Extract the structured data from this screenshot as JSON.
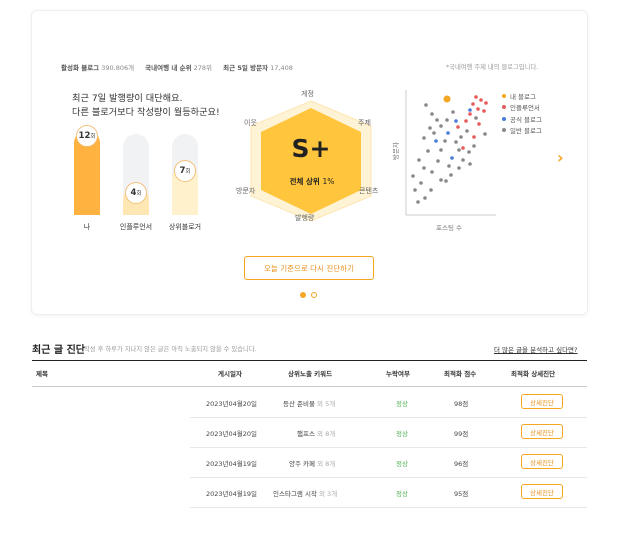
{
  "stats": {
    "active_label": "활성화 블로그",
    "active_value": "390,806개",
    "rank_label": "국내여행 내 순위",
    "rank_value": "278위",
    "visitor_label": "최근 5일 방문자",
    "visitor_value": "17,408",
    "note": "*국내여행 주제 내의 블로그입니다."
  },
  "headline": {
    "line1": "최근 7일 발행량이 대단해요.",
    "line2": "다른 블로거보다 작성량이 월등하군요!"
  },
  "bars": [
    {
      "label": "나",
      "count": "12",
      "unit": "회",
      "value": 12,
      "color": "#ffb23f"
    },
    {
      "label": "인플루언서",
      "count": "4",
      "unit": "회",
      "value": 4,
      "color": "#ffe7b3"
    },
    {
      "label": "상위블로거",
      "count": "7",
      "unit": "회",
      "value": 7,
      "color": "#fff1cc"
    }
  ],
  "hexagon": {
    "grade": "S+",
    "rank_prefix": "전체 상위",
    "rank_value": "1%",
    "labels": {
      "top": "게정",
      "top_right": "주제",
      "bottom_right": "콘텐츠",
      "bottom": "발행량",
      "bottom_left": "방문자",
      "top_left": "이웃"
    },
    "fill_color": "#ffc53d",
    "outer_color": "#fff3d6"
  },
  "scatter": {
    "ylabel": "방문자",
    "xlabel": "포스팅 수",
    "legend": [
      {
        "label": "내 블로그",
        "color": "#f5a623"
      },
      {
        "label": "인플루언서",
        "color": "#e85a5a"
      },
      {
        "label": "공식 블로그",
        "color": "#4a7bd8"
      },
      {
        "label": "일반 블로그",
        "color": "#888888"
      }
    ]
  },
  "cta_label": "오늘 기준으로 다시 진단하기",
  "next_icon": "chevron-right-icon",
  "section": {
    "title": "최근 글 진단",
    "desc": "작성 후 하루가 지나지 않은 글은 아직 노출되지 않을 수 있습니다.",
    "link": "더 많은 글을 분석하고 싶다면?"
  },
  "table": {
    "headers": [
      "제목",
      "게시일자",
      "상위노출 키워드",
      "누락여부",
      "최적화 점수",
      "최적화 상세진단"
    ],
    "rows": [
      {
        "date": "2023년04월20일",
        "keyword": "등산 준비물",
        "extra": "외 5개",
        "status": "정상",
        "score": "98점",
        "action": "상세진단"
      },
      {
        "date": "2023년04월20일",
        "keyword": "햄프스",
        "extra": "외 8개",
        "status": "정상",
        "score": "99점",
        "action": "상세진단"
      },
      {
        "date": "2023년04월19일",
        "keyword": "양주 카페",
        "extra": "외 8개",
        "status": "정상",
        "score": "96점",
        "action": "상세진단"
      },
      {
        "date": "2023년04월19일",
        "keyword": "인스타그램 시작",
        "extra": "외 3개",
        "status": "정상",
        "score": "95점",
        "action": "상세진단"
      }
    ]
  }
}
